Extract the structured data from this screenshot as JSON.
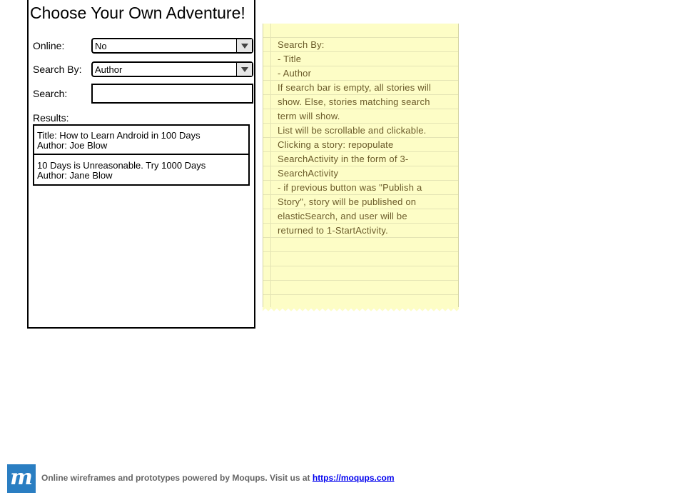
{
  "screen": {
    "title": "Choose Your Own Adventure!",
    "online": {
      "label": "Online:",
      "value": "No"
    },
    "search_by": {
      "label": "Search By:",
      "value": "Author"
    },
    "search": {
      "label": "Search:",
      "value": ""
    },
    "results_label": "Results:",
    "results": [
      {
        "line1": "Title: How to Learn Android in 100 Days",
        "line2": "Author: Joe Blow"
      },
      {
        "line1": "10 Days is Unreasonable. Try 1000 Days",
        "line2": "Author: Jane Blow"
      }
    ]
  },
  "note": {
    "lines": [
      "Search By:",
      "- Title",
      "- Author",
      "",
      "If search bar is empty, all stories will",
      "show. Else, stories matching search",
      "term will show.",
      "",
      "List will be scrollable and clickable.",
      "",
      "Clicking a story: repopulate",
      "SearchActivity in the form of 3-",
      "SearchActivity",
      "- if previous button was \"Publish a",
      "Story\", story will be published on",
      "elasticSearch, and user will be",
      "returned to 1-StartActivity."
    ]
  },
  "footer": {
    "logo_letter": "m",
    "text": "Online wireframes and prototypes powered by Moqups. Visit us at ",
    "link": "https://moqups.com"
  }
}
